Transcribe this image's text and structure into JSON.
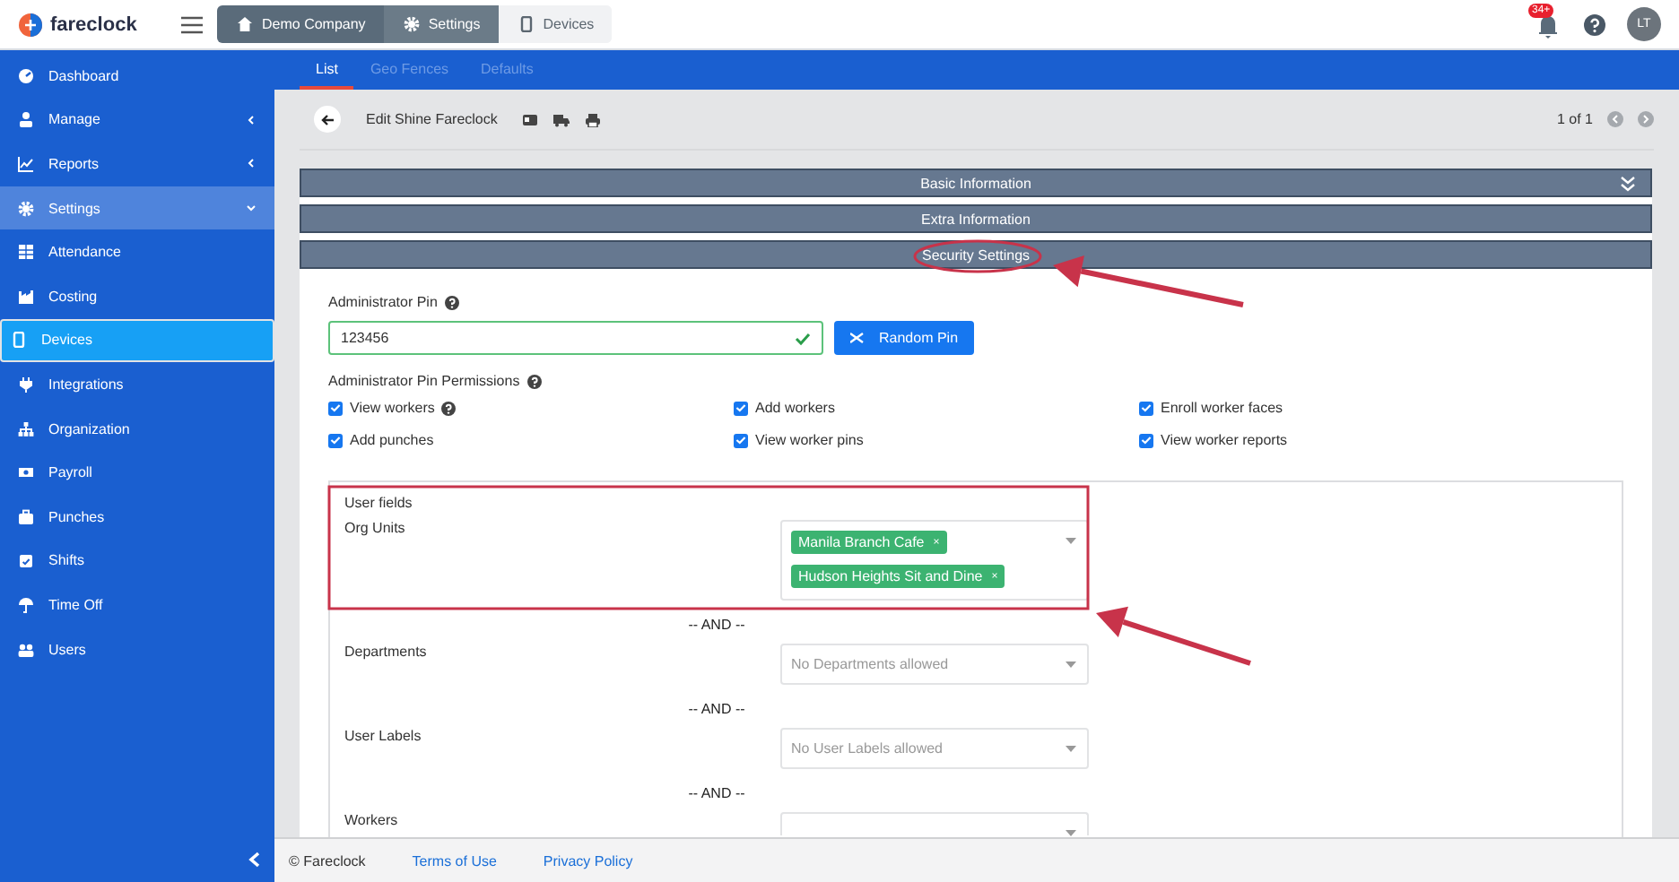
{
  "header": {
    "logo": "fareclock",
    "breadcrumbs": [
      {
        "label": "Demo Company",
        "kind": "home",
        "current": false
      },
      {
        "label": "Settings",
        "kind": "gear",
        "current": false
      },
      {
        "label": "Devices",
        "kind": "device",
        "current": true
      }
    ],
    "notification_count": "34+",
    "avatar": "LT"
  },
  "sidebar": {
    "items": [
      {
        "label": "Dashboard",
        "selected": false
      },
      {
        "label": "Manage",
        "selected": false,
        "expanded": false
      },
      {
        "label": "Reports",
        "selected": false,
        "expanded": false
      },
      {
        "label": "Settings",
        "selected": false,
        "expanded": true,
        "children": [
          {
            "label": "Attendance",
            "selected": false
          },
          {
            "label": "Costing",
            "selected": false
          },
          {
            "label": "Devices",
            "selected": true
          },
          {
            "label": "Integrations",
            "selected": false
          },
          {
            "label": "Organization",
            "selected": false
          },
          {
            "label": "Payroll",
            "selected": false
          },
          {
            "label": "Punches",
            "selected": false
          },
          {
            "label": "Shifts",
            "selected": false
          },
          {
            "label": "Time Off",
            "selected": false
          },
          {
            "label": "Users",
            "selected": false
          }
        ]
      }
    ]
  },
  "tabs": [
    {
      "label": "List",
      "selected": true
    },
    {
      "label": "Geo Fences",
      "selected": false
    },
    {
      "label": "Defaults",
      "selected": false
    }
  ],
  "toolbar": {
    "title": "Edit Shine Fareclock",
    "pager": "1 of 1"
  },
  "sections": [
    {
      "title": "Basic Information"
    },
    {
      "title": "Extra Information"
    },
    {
      "title": "Security Settings"
    }
  ],
  "security": {
    "pin_label": "Administrator Pin",
    "pin_value": "123456",
    "pin_valid": true,
    "random_button": "Random Pin",
    "permissions_label": "Administrator Pin Permissions",
    "permissions": [
      {
        "label": "View workers",
        "checked": true,
        "help": true
      },
      {
        "label": "Add workers",
        "checked": true,
        "help": false
      },
      {
        "label": "Enroll worker faces",
        "checked": true,
        "help": false
      },
      {
        "label": "Add punches",
        "checked": true,
        "help": false
      },
      {
        "label": "View worker pins",
        "checked": true,
        "help": false
      },
      {
        "label": "View worker reports",
        "checked": true,
        "help": false
      }
    ],
    "user_fields_title": "User fields",
    "fields": [
      {
        "label": "Org Units",
        "tags": [
          {
            "label": "Manila Branch Cafe",
            "remove": "×"
          },
          {
            "label": "Hudson Heights Sit and Dine",
            "remove": "×"
          }
        ]
      },
      {
        "separator": "-- AND --",
        "label": "Departments",
        "placeholder": "No Departments allowed"
      },
      {
        "separator": "-- AND --",
        "label": "User Labels",
        "placeholder": "No User Labels allowed"
      },
      {
        "separator": "-- AND --",
        "label": "Workers"
      }
    ]
  },
  "annotations": [
    {
      "kind": "ellipse"
    },
    {
      "kind": "arrow"
    },
    {
      "kind": "rectangle"
    },
    {
      "kind": "arrow"
    }
  ],
  "footer": {
    "copyright": "© Fareclock",
    "links": [
      "Terms of Use",
      "Privacy Policy"
    ]
  }
}
